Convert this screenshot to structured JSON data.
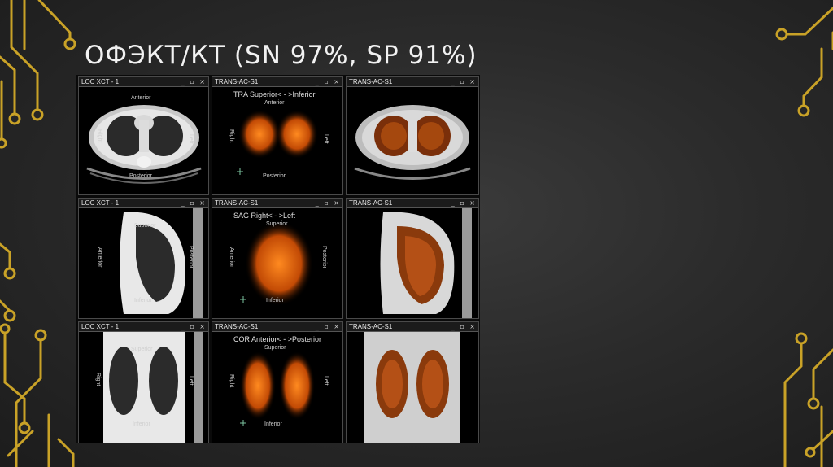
{
  "slide": {
    "title": "ОФЭКТ/КТ (SN 97%, SP 91%)"
  },
  "panels": [
    {
      "header": "LOC XCT - 1",
      "view_title": "",
      "labels": {
        "top": "Anterior",
        "bottom": "Posterior",
        "left": "Right",
        "right": "Left"
      }
    },
    {
      "header": "TRANS-AC-S1",
      "view_title": "TRA Superior< - >Inferior",
      "labels": {
        "top": "Anterior",
        "bottom": "Posterior",
        "left": "Right",
        "right": "Left"
      }
    },
    {
      "header": "TRANS-AC-S1",
      "view_title": "",
      "labels": {
        "top": "",
        "bottom": "",
        "left": "",
        "right": ""
      }
    },
    {
      "header": "LOC XCT - 1",
      "view_title": "",
      "labels": {
        "top": "Superior",
        "bottom": "Inferior",
        "left": "Anterior",
        "right": "Posterior"
      }
    },
    {
      "header": "TRANS-AC-S1",
      "view_title": "SAG Right< - >Left",
      "labels": {
        "top": "Superior",
        "bottom": "Inferior",
        "left": "Anterior",
        "right": "Posterior"
      }
    },
    {
      "header": "TRANS-AC-S1",
      "view_title": "",
      "labels": {
        "top": "",
        "bottom": "",
        "left": "",
        "right": ""
      }
    },
    {
      "header": "LOC XCT - 1",
      "view_title": "",
      "labels": {
        "top": "Superior",
        "bottom": "Inferior",
        "left": "Right",
        "right": "Left"
      }
    },
    {
      "header": "TRANS-AC-S1",
      "view_title": "COR Anterior< - >Posterior",
      "labels": {
        "top": "Superior",
        "bottom": "Inferior",
        "left": "Right",
        "right": "Left"
      }
    },
    {
      "header": "TRANS-AC-S1",
      "view_title": "",
      "labels": {
        "top": "",
        "bottom": "",
        "left": "",
        "right": ""
      }
    }
  ],
  "window_controls": "_ ▫ ×",
  "colors": {
    "title": "#f2f2f2",
    "circuit": "#c9a227",
    "spect": "#ff7a1a",
    "background": "#2b2b2b"
  }
}
